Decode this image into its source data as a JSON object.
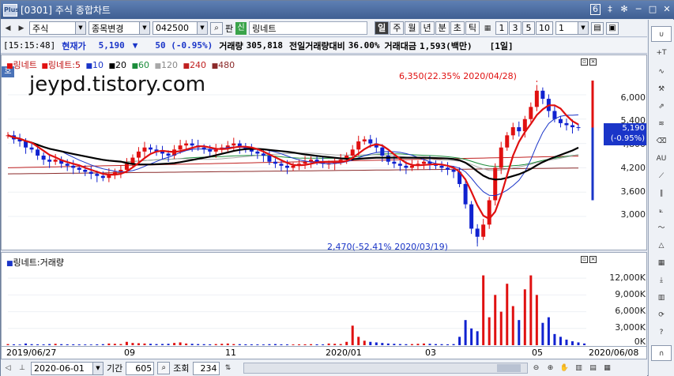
{
  "window": {
    "screen_no": "[0301]",
    "title": "주식 종합차트",
    "screen_badge": "6",
    "ctrl_pin": "‡",
    "ctrl_star": "✻",
    "ctrl_min": "─",
    "ctrl_max": "□",
    "ctrl_close": "✕"
  },
  "toolbar": {
    "market": "주식",
    "market_options": "종목변경",
    "code": "042500",
    "pan_label": "판",
    "sin_label": "신",
    "stock_name": "링네트",
    "periods": [
      "일",
      "주",
      "월",
      "년",
      "분",
      "초",
      "틱"
    ],
    "active_period": "일",
    "numbers": [
      "1",
      "3",
      "5",
      "10"
    ],
    "interval": "1"
  },
  "infobar": {
    "time": "[15:15:48]",
    "price_label": "현재가",
    "price": "5,190",
    "change_arrow": "▼",
    "change": "50 (-0.95%)",
    "volume_label": "거래량",
    "volume": "305,818",
    "prev_ratio_label": "전일거래량대비",
    "prev_ratio": "36.00%",
    "value_label": "거래대금",
    "value": "1,593(백만)",
    "period_tag": "[1일]"
  },
  "price_pane": {
    "tag": "호",
    "watermark": "jeypd.tistory.com",
    "legend": {
      "stock": "링네트",
      "ma_prefix": "링네트:5",
      "ma_list": [
        "10",
        "20",
        "60",
        "120",
        "240",
        "480"
      ]
    },
    "high_annotation": "6,350(22.35% 2020/04/28)",
    "low_annotation": "2,470(-52.41% 2020/03/19)",
    "y_ticks": [
      "6,000",
      "5,400",
      "4,800",
      "4,200",
      "3,600",
      "3,000"
    ],
    "current_price_tag": "5,190",
    "current_change_tag": "(-0.95%)"
  },
  "volume_pane": {
    "legend": "링네트:거래량",
    "y_ticks": [
      "12,000K",
      "9,000K",
      "6,000K",
      "3,000K",
      "0K"
    ]
  },
  "x_axis": {
    "labels": [
      "2019/06/27",
      "09",
      "11",
      "2020/01",
      "03",
      "05",
      "2020/06/08"
    ]
  },
  "statusbar": {
    "date": "2020-06-01",
    "period_label": "기간",
    "period_value": "605",
    "lookup_label": "조회",
    "count": "234"
  },
  "colors": {
    "up": "#e01010",
    "down": "#1022d0",
    "ma5": "#e01010",
    "ma10": "#1a35c8",
    "ma20": "#000000",
    "ma60": "#1a8c3a",
    "ma120": "#a8a8a8",
    "ma240": "#c02020",
    "ma480": "#8b2a2a"
  },
  "chart_data": {
    "type": "candlestick",
    "ylim": [
      2300,
      6700
    ],
    "high": 6350,
    "low": 2470,
    "closes": [
      5000,
      4900,
      4850,
      4700,
      4650,
      4500,
      4400,
      4350,
      4400,
      4300,
      4250,
      4200,
      4150,
      4100,
      4050,
      4000,
      3950,
      4050,
      4100,
      4150,
      4300,
      4450,
      4600,
      4700,
      4650,
      4600,
      4550,
      4500,
      4650,
      4750,
      4800,
      4750,
      4700,
      4650,
      4600,
      4650,
      4700,
      4750,
      4800,
      4700,
      4650,
      4600,
      4550,
      4500,
      4350,
      4300,
      4250,
      4200,
      4250,
      4300,
      4350,
      4400,
      4350,
      4300,
      4300,
      4350,
      4400,
      4500,
      4650,
      4850,
      4900,
      4800,
      4700,
      4500,
      4350,
      4300,
      4250,
      4200,
      4250,
      4300,
      4350,
      4300,
      4250,
      4200,
      4150,
      4100,
      3800,
      3300,
      2700,
      2500,
      2800,
      3400,
      4200,
      4700,
      5000,
      5200,
      5100,
      5400,
      5700,
      6100,
      5900,
      5600,
      5400,
      5300,
      5250,
      5200,
      5190
    ],
    "volume_k": [
      200,
      150,
      120,
      300,
      180,
      160,
      140,
      200,
      250,
      180,
      160,
      150,
      140,
      130,
      120,
      150,
      180,
      300,
      250,
      200,
      600,
      400,
      350,
      300,
      250,
      200,
      220,
      250,
      400,
      500,
      300,
      250,
      200,
      180,
      160,
      200,
      250,
      300,
      200,
      180,
      160,
      150,
      140,
      130,
      180,
      200,
      150,
      140,
      130,
      150,
      160,
      180,
      160,
      140,
      300,
      250,
      200,
      600,
      3500,
      1500,
      800,
      600,
      500,
      400,
      300,
      250,
      200,
      180,
      200,
      250,
      300,
      250,
      200,
      180,
      160,
      200,
      1500,
      4500,
      3000,
      2500,
      12500,
      5000,
      9000,
      6000,
      11000,
      7000,
      4500,
      10000,
      12500,
      9000,
      4000,
      5000,
      2000,
      1500,
      1000,
      700,
      500,
      306
    ]
  }
}
